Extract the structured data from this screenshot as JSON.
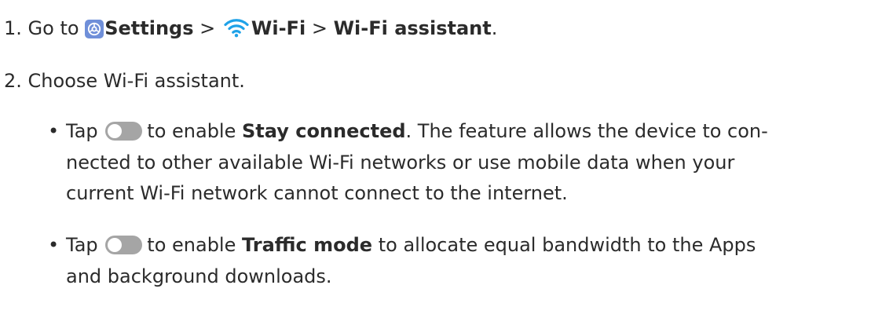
{
  "steps": [
    {
      "number": "1.",
      "prefix": "Go to",
      "settings_label": "Settings",
      "sep1": ">",
      "wifi_label": "Wi-Fi",
      "sep2": ">",
      "assistant_label": "Wi-Fi assistant",
      "suffix": "."
    },
    {
      "number": "2.",
      "text": "Choose Wi-Fi assistant."
    }
  ],
  "bullets": [
    {
      "tap": "Tap",
      "enable": "to enable",
      "feature": "Stay connected",
      "rest_line1": ". The feature allows the device to con-",
      "line2": "nected to other available Wi-Fi networks or use mobile data when your",
      "line3": "current Wi-Fi network cannot connect to the internet."
    },
    {
      "tap": "Tap",
      "enable": "to enable",
      "feature": "Traffic mode",
      "rest_line1": "to allocate equal bandwidth to the Apps",
      "line2": "and background downloads."
    }
  ],
  "colors": {
    "text": "#2b2b2b",
    "settings_icon": "#6f8fd9",
    "wifi_icon": "#1fa2e8",
    "toggle": "#a5a5a5"
  },
  "icons": {
    "settings": "settings-gear-icon",
    "wifi": "wifi-icon",
    "toggle": "toggle-off-icon"
  }
}
